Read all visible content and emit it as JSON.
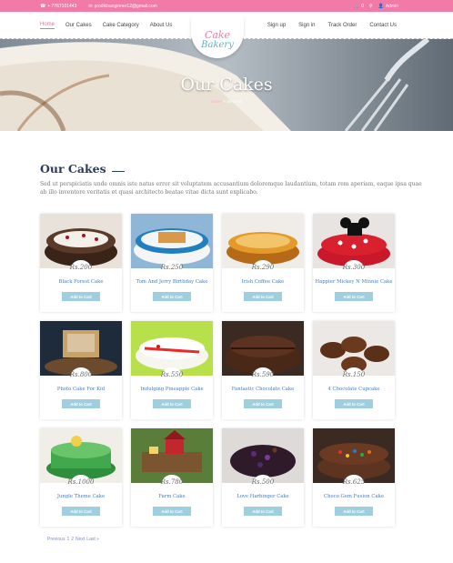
{
  "topbar": {
    "phone_icon": "phone-icon",
    "phone": "+ 7767101443",
    "email_icon": "mail-icon",
    "email": "prodikbanginner12@gmail.com",
    "cart_icon": "cart-icon",
    "cart_count": "0",
    "search_icon": "search-icon",
    "user_icon": "user-icon",
    "admin": "Admin"
  },
  "nav": {
    "left": [
      "Home",
      "Our Cakes",
      "Cake Category",
      "About Us"
    ],
    "right": [
      "Sign up",
      "Sign in",
      "Track Order",
      "Contact Us"
    ]
  },
  "logo": {
    "line1": "Cake",
    "line2": "Bakery"
  },
  "hero": {
    "title": "Our Cakes",
    "breadcrumb_home": "Home",
    "breadcrumb_sep": " > ",
    "breadcrumb_current": "Services"
  },
  "section": {
    "title": "Our Cakes",
    "intro": "Sed ut perspiciatis unde omnis iste natus error sit voluptatem accusantium doloremque laudantium, totam rem aperiam, eaque ipsa quae ab illo inventore veritatis et quasi architecto beatae vitae dicta sunt explicabo."
  },
  "products": [
    {
      "name": "Black Forest Cake",
      "price": "Rs.200",
      "button": "Add to Cart"
    },
    {
      "name": "Tom And Jerry Birthday Cake",
      "price": "Rs.250",
      "button": "Add to Cart"
    },
    {
      "name": "Irish Coffee Cake",
      "price": "Rs.290",
      "button": "Add to Cart"
    },
    {
      "name": "Happier Mickey N Minnie Cake",
      "price": "Rs.300",
      "button": "Add to Cart"
    },
    {
      "name": "Photo Cake For Kid",
      "price": "Rs.800",
      "button": "Add to Cart"
    },
    {
      "name": "Indulging Pineapple Cake",
      "price": "Rs.550",
      "button": "Add to Cart"
    },
    {
      "name": "Fantastic Chocolate Cake",
      "price": "Rs.590",
      "button": "Add to Cart"
    },
    {
      "name": "4 Chocolate Cupcake",
      "price": "Rs.150",
      "button": "Add to Cart"
    },
    {
      "name": "Jungle Theme Cake",
      "price": "Rs.1000",
      "button": "Add to Cart"
    },
    {
      "name": "Farm Cake",
      "price": "Rs.780",
      "button": "Add to Cart"
    },
    {
      "name": "Love Harbinger Cake",
      "price": "Rs.500",
      "button": "Add to Cart"
    },
    {
      "name": "Choco Gem Fusion Cake",
      "price": "Rs.625",
      "button": "Add to Cart"
    }
  ],
  "pagination": {
    "prev": "Previous",
    "pages": [
      "1",
      "2"
    ],
    "next": "Next",
    "last": "Last »"
  },
  "colors": {
    "accent_pink": "#f27aa6",
    "button_blue": "#9fcfde",
    "link_blue": "#4a7bbd",
    "title_navy": "#2c3b55"
  }
}
